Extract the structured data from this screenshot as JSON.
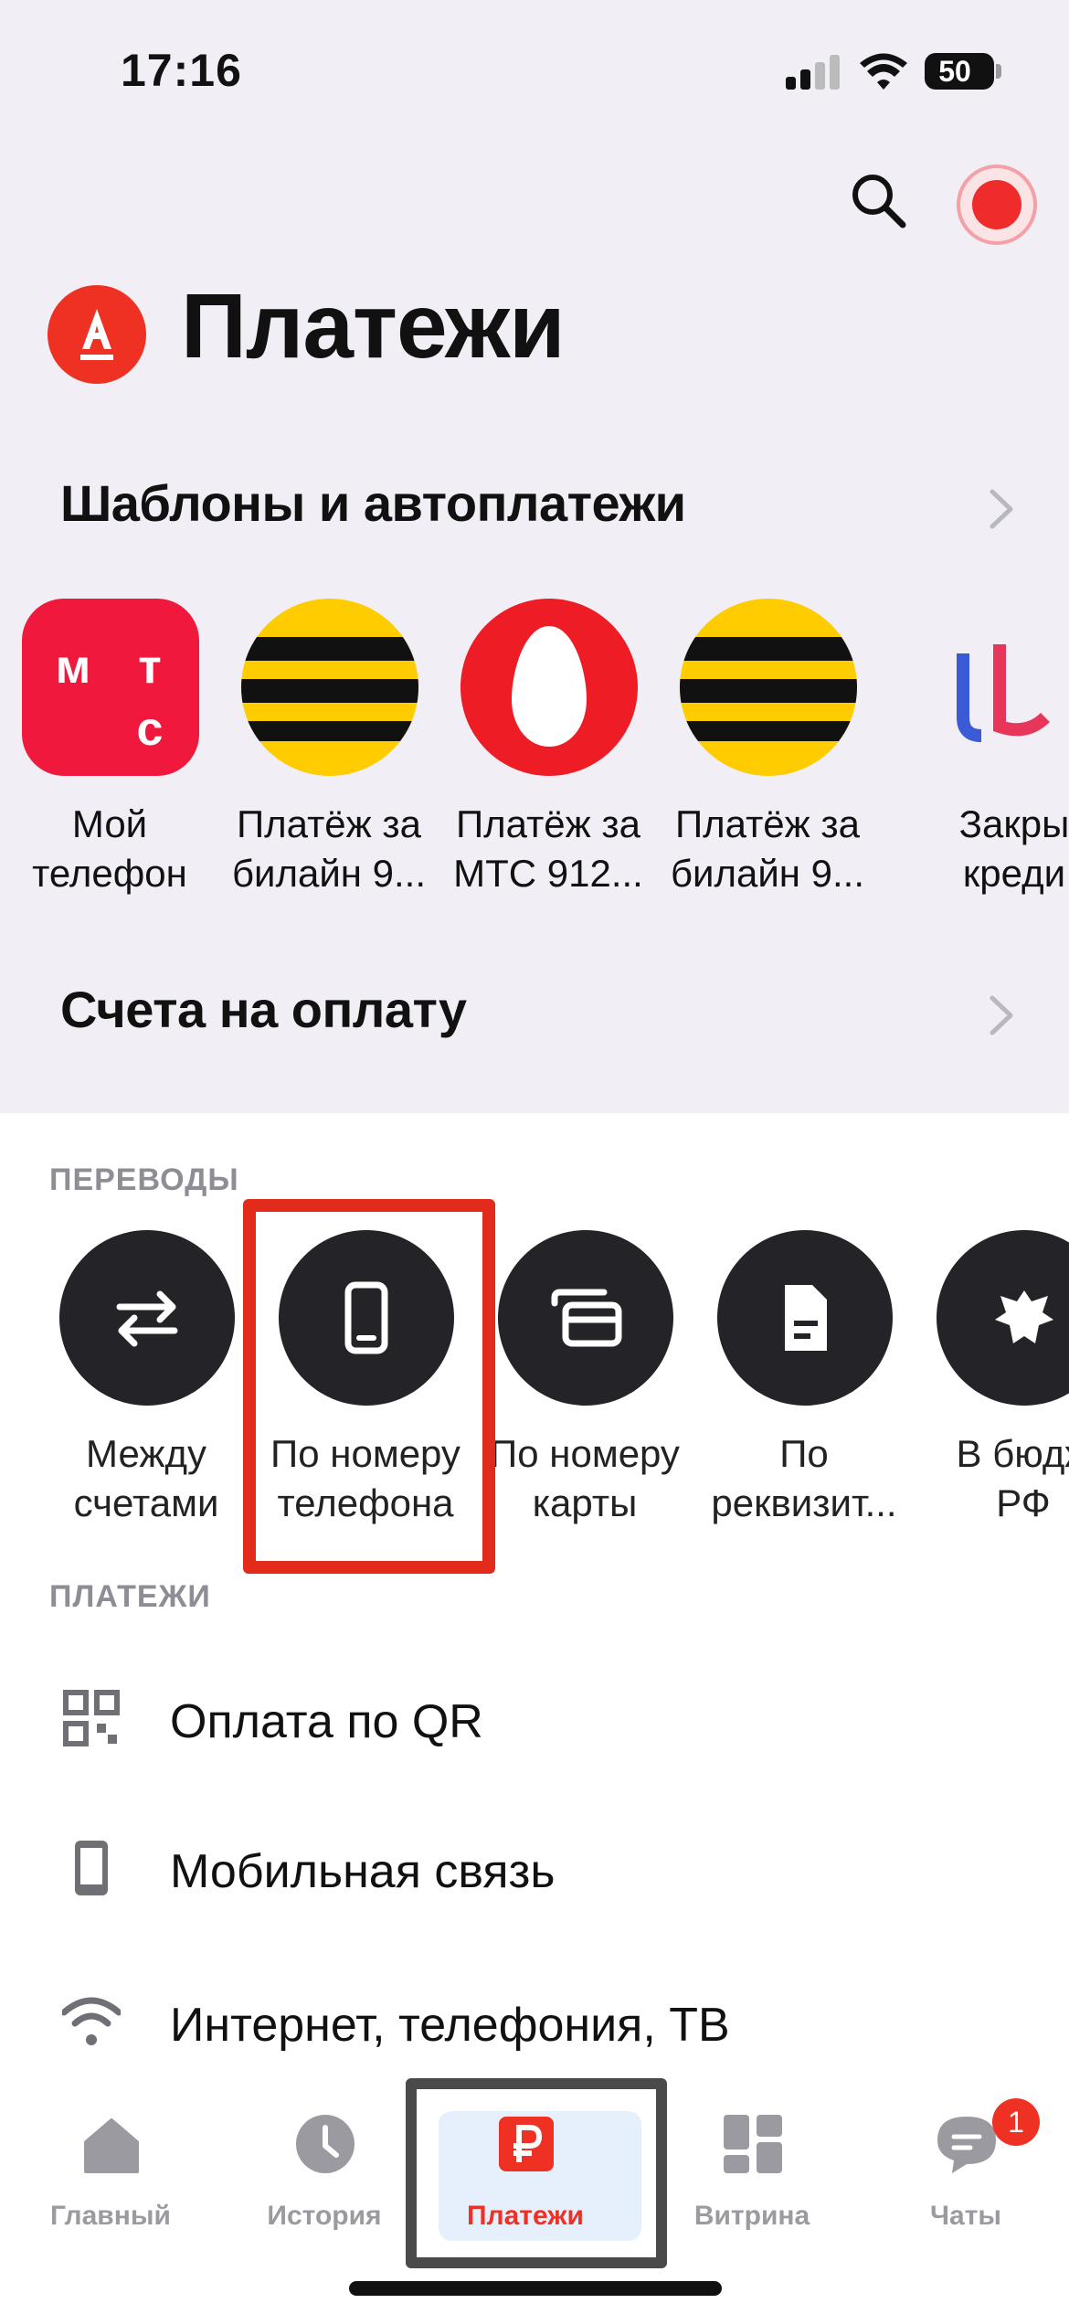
{
  "status_bar": {
    "time": "17:16",
    "battery": "50"
  },
  "header": {
    "title": "Платежи"
  },
  "templates_section": {
    "title": "Шаблоны и автоплатежи",
    "items": [
      {
        "label": "Мой\nтелефон",
        "icon": "mts-logo-icon"
      },
      {
        "label": "Платёж за\nбилайн 9...",
        "icon": "beeline-logo-icon"
      },
      {
        "label": "Платёж за\nМТС 912...",
        "icon": "mts-egg-logo-icon"
      },
      {
        "label": "Платёж за\nбилайн 9...",
        "icon": "beeline-logo-icon"
      },
      {
        "label": "Закры\nкреди",
        "icon": "loan-logo-icon"
      }
    ]
  },
  "bills_section": {
    "title": "Счета на оплату"
  },
  "transfers": {
    "caption": "ПЕРЕВОДЫ",
    "items": [
      {
        "label": "Между\nсчетами",
        "icon": "arrows-swap-icon"
      },
      {
        "label": "По номеру\nтелефона",
        "icon": "phone-icon"
      },
      {
        "label": "По номеру\nкарты",
        "icon": "card-icon"
      },
      {
        "label": "По\nреквизит...",
        "icon": "document-icon"
      },
      {
        "label": "В бюдж\nРФ",
        "icon": "eagle-emblem-icon"
      }
    ]
  },
  "payments": {
    "caption": "ПЛАТЕЖИ",
    "items": [
      {
        "label": "Оплата по QR",
        "icon": "qr-code-icon"
      },
      {
        "label": "Мобильная связь",
        "icon": "mobile-phone-icon"
      },
      {
        "label": "Интернет, телефония, ТВ",
        "icon": "wifi-icon"
      }
    ]
  },
  "tabbar": {
    "active": "Платежи",
    "tabs": [
      {
        "label": "Главный",
        "icon": "home-icon"
      },
      {
        "label": "История",
        "icon": "clock-icon"
      },
      {
        "label": "Платежи",
        "icon": "ruble-icon"
      },
      {
        "label": "Витрина",
        "icon": "showcase-grid-icon"
      },
      {
        "label": "Чаты",
        "icon": "chat-bubble-icon",
        "badge": "1"
      }
    ]
  },
  "colors": {
    "accent": "#ef3124",
    "highlight": "#e22b1b",
    "dark_circle": "#232328",
    "active_tab_bg": "#e6f0fd"
  }
}
